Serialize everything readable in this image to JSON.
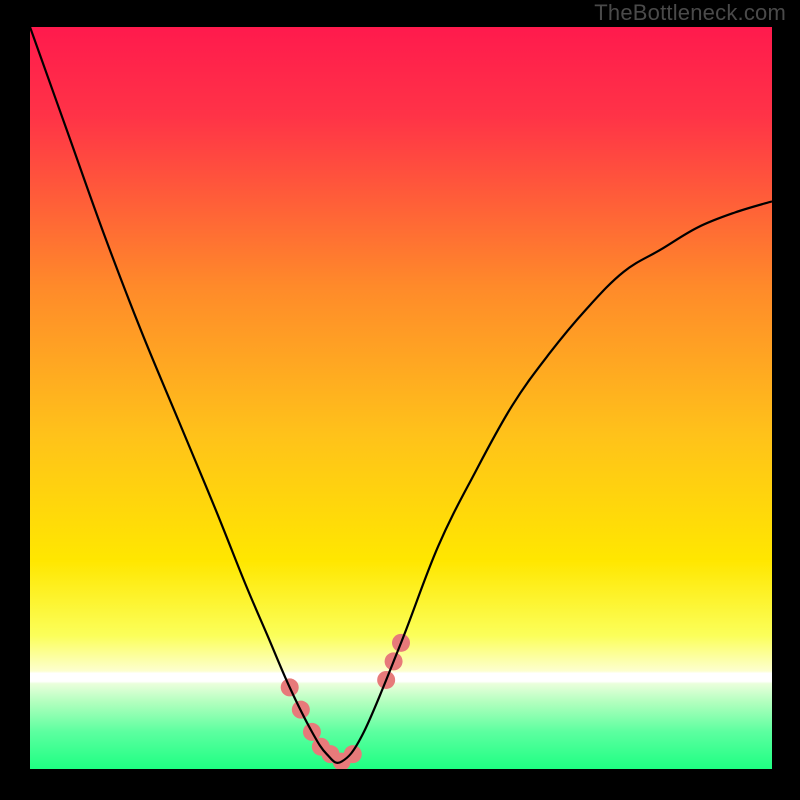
{
  "watermark": "TheBottleneck.com",
  "chart_data": {
    "type": "line",
    "title": "",
    "xlabel": "",
    "ylabel": "",
    "xlim": [
      0,
      100
    ],
    "ylim": [
      0,
      100
    ],
    "background_gradient": {
      "top_color": "#ff1a4d",
      "mid_color": "#ffd400",
      "near_bottom_color": "#f9ffb0",
      "bottom_color": "#2cff87",
      "white_band_y": 87
    },
    "series": [
      {
        "name": "bottleneck-curve",
        "x": [
          0,
          5,
          10,
          15,
          20,
          25,
          29,
          32,
          35,
          38,
          40,
          42,
          45,
          50,
          55,
          60,
          65,
          70,
          75,
          80,
          85,
          90,
          95,
          100
        ],
        "y": [
          100,
          86,
          72,
          59,
          47,
          35,
          25,
          18,
          11,
          5,
          2,
          1,
          5,
          17,
          30,
          40,
          49,
          56,
          62,
          67,
          70,
          73,
          75,
          76.5
        ],
        "color": "#000000",
        "stroke_width": 2.2
      }
    ],
    "highlight_markers": {
      "name": "bottom-markers",
      "color": "#e77a7a",
      "radius": 9,
      "points": [
        {
          "x": 35.0,
          "y": 11
        },
        {
          "x": 36.5,
          "y": 8
        },
        {
          "x": 38.0,
          "y": 5
        },
        {
          "x": 39.2,
          "y": 3
        },
        {
          "x": 40.5,
          "y": 2
        },
        {
          "x": 42.0,
          "y": 1
        },
        {
          "x": 43.5,
          "y": 2
        },
        {
          "x": 48.0,
          "y": 12
        },
        {
          "x": 49.0,
          "y": 14.5
        },
        {
          "x": 50.0,
          "y": 17
        }
      ]
    }
  }
}
